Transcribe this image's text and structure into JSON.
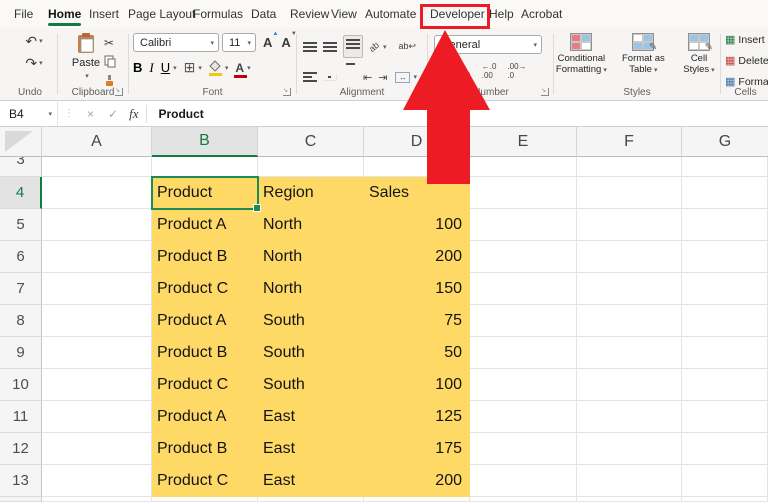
{
  "tabs": [
    {
      "label": "File"
    },
    {
      "label": "Home"
    },
    {
      "label": "Insert"
    },
    {
      "label": "Page Layout"
    },
    {
      "label": "Formulas"
    },
    {
      "label": "Data"
    },
    {
      "label": "Review"
    },
    {
      "label": "View"
    },
    {
      "label": "Automate"
    },
    {
      "label": "Developer"
    },
    {
      "label": "Help"
    },
    {
      "label": "Acrobat"
    }
  ],
  "ribbon": {
    "undo": {
      "label": "Undo"
    },
    "clipboard": {
      "label": "Clipboard",
      "paste_label": "Paste"
    },
    "font": {
      "label": "Font",
      "family": "Calibri",
      "size": "11",
      "bold": "B",
      "italic": "I",
      "underline": "U"
    },
    "alignment": {
      "label": "Alignment"
    },
    "number": {
      "label": "Number",
      "format": "General",
      "percent": "%"
    },
    "styles": {
      "label": "Styles",
      "conditional": "Conditional Formatting",
      "format_table": "Format as Table",
      "cell_styles": "Cell Styles"
    },
    "cells": {
      "label": "Cells",
      "insert": "Insert",
      "delete": "Delete",
      "format": "Format"
    }
  },
  "formula_bar": {
    "name_box": "B4",
    "fx": "fx",
    "value": "Product"
  },
  "sheet": {
    "column_headers": [
      "A",
      "B",
      "C",
      "D",
      "E",
      "F",
      "G"
    ],
    "partial_row": "3",
    "selected_cell": "B4",
    "selected_column": "B",
    "selected_row": "4",
    "highlight_fill": "#FFD966",
    "rows": [
      {
        "n": "4",
        "b": "Product",
        "c": "Region",
        "d": "Sales"
      },
      {
        "n": "5",
        "b": "Product A",
        "c": "North",
        "d": "100"
      },
      {
        "n": "6",
        "b": "Product B",
        "c": "North",
        "d": "200"
      },
      {
        "n": "7",
        "b": "Product C",
        "c": "North",
        "d": "150"
      },
      {
        "n": "8",
        "b": "Product A",
        "c": "South",
        "d": "75"
      },
      {
        "n": "9",
        "b": "Product B",
        "c": "South",
        "d": "50"
      },
      {
        "n": "10",
        "b": "Product C",
        "c": "South",
        "d": "100"
      },
      {
        "n": "11",
        "b": "Product A",
        "c": "East",
        "d": "125"
      },
      {
        "n": "12",
        "b": "Product B",
        "c": "East",
        "d": "175"
      },
      {
        "n": "13",
        "b": "Product C",
        "c": "East",
        "d": "200"
      }
    ]
  },
  "annotation": {
    "color": "#ED1C24",
    "target": "Developer"
  }
}
